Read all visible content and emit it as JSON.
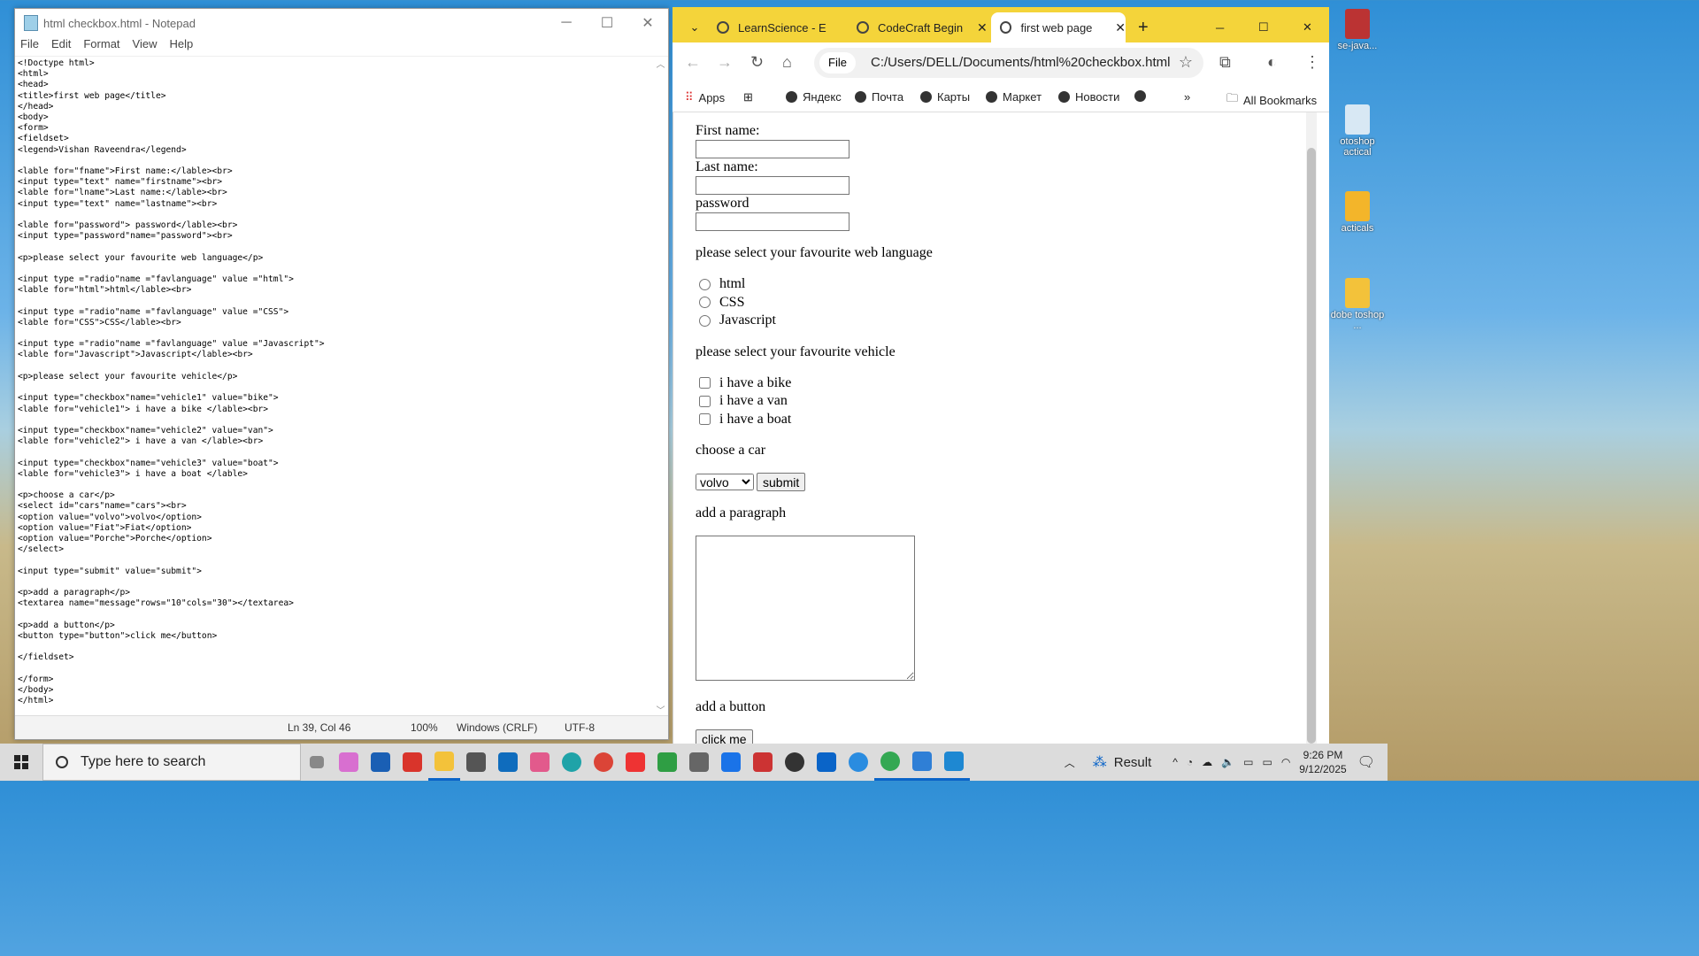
{
  "notepad": {
    "title": "html checkbox.html - Notepad",
    "menu": [
      "File",
      "Edit",
      "Format",
      "View",
      "Help"
    ],
    "code": "<!Doctype html>\n<html>\n<head>\n<title>first web page</title>\n</head>\n<body>\n<form>\n<fieldset>\n<legend>Vishan Raveendra</legend>\n\n<lable for=\"fname\">First name:</lable><br>\n<input type=\"text\" name=\"firstname\"><br>\n<lable for=\"lname\">Last name:</lable><br>\n<input type=\"text\" name=\"lastname\"><br>\n\n<lable for=\"password\"> password</lable><br>\n<input type=\"password\"name=\"password\"><br>\n\n<p>please select your favourite web language</p>\n\n<input type =\"radio\"name =\"favlanguage\" value =\"html\">\n<lable for=\"html\">html</lable><br>\n\n<input type =\"radio\"name =\"favlanguage\" value =\"CSS\">\n<lable for=\"CSS\">CSS</lable><br>\n\n<input type =\"radio\"name =\"favlanguage\" value =\"Javascript\">\n<lable for=\"Javascript\">Javascript</lable><br>\n\n<p>please select your favourite vehicle</p>\n\n<input type=\"checkbox\"name=\"vehicle1\" value=\"bike\">\n<lable for=\"vehicle1\"> i have a bike </lable><br>\n\n<input type=\"checkbox\"name=\"vehicle2\" value=\"van\">\n<lable for=\"vehicle2\"> i have a van </lable><br>\n\n<input type=\"checkbox\"name=\"vehicle3\" value=\"boat\">\n<lable for=\"vehicle3\"> i have a boat </lable>\n\n<p>choose a car</p>\n<select id=\"cars\"name=\"cars\"><br>\n<option value=\"volvo\">volvo</option>\n<option value=\"Fiat\">Fiat</option>\n<option value=\"Porche\">Porche</option>\n</select>\n\n<input type=\"submit\" value=\"submit\">\n\n<p>add a paragraph</p>\n<textarea name=\"message\"rows=\"10\"cols=\"30\"></textarea>\n\n<p>add a button</p>\n<button type=\"button\">click me</button>\n\n</fieldset>\n\n</form>\n</body>\n</html>",
    "status": {
      "position": "Ln 39, Col 46",
      "zoom": "100%",
      "line_ending": "Windows (CRLF)",
      "encoding": "UTF-8"
    }
  },
  "chrome": {
    "tabs": [
      {
        "label": "LearnScience - E"
      },
      {
        "label": "CodeCraft Begin"
      },
      {
        "label": "first web page"
      }
    ],
    "omnibox": {
      "chip": "File",
      "url": "C:/Users/DELL/Documents/html%20checkbox.html"
    },
    "bookmarks": [
      "Apps",
      "Яндекс",
      "Почта",
      "Карты",
      "Маркет",
      "Новости"
    ],
    "all_bookmarks": "All Bookmarks",
    "form": {
      "first_name_label": "First name:",
      "last_name_label": "Last name:",
      "password_label": "password",
      "language_prompt": "please select your favourite web language",
      "languages": [
        "html",
        "CSS",
        "Javascript"
      ],
      "vehicle_prompt": "please select your favourite vehicle",
      "vehicles": [
        "i have a bike",
        "i have a van",
        "i have a boat"
      ],
      "car_prompt": "choose a car",
      "car_selected": "volvo",
      "submit_label": "submit",
      "paragraph_prompt": "add a paragraph",
      "button_prompt": "add a button",
      "button_label": "click me"
    }
  },
  "desktop": {
    "icons": [
      "se-java...",
      "otoshop actical",
      "acticals",
      "dobe toshop ..."
    ]
  },
  "taskbar": {
    "search_placeholder": "Type here to search",
    "weather": "Result",
    "time": "9:26 PM",
    "date": "9/12/2025"
  },
  "colors": {
    "chrome_accent": "#f4d43a",
    "taskbar": "#dcdcdc"
  }
}
